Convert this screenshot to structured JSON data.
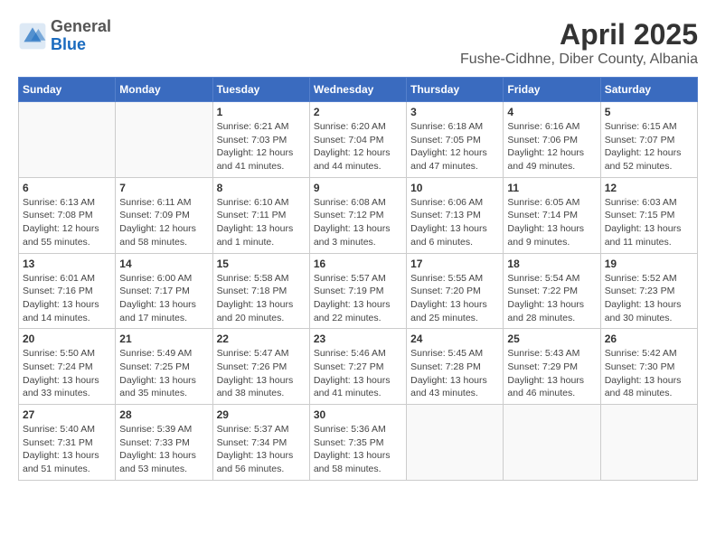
{
  "header": {
    "logo": {
      "general": "General",
      "blue": "Blue"
    },
    "month": "April 2025",
    "location": "Fushe-Cidhne, Diber County, Albania"
  },
  "weekdays": [
    "Sunday",
    "Monday",
    "Tuesday",
    "Wednesday",
    "Thursday",
    "Friday",
    "Saturday"
  ],
  "weeks": [
    [
      {
        "day": null,
        "info": null
      },
      {
        "day": null,
        "info": null
      },
      {
        "day": "1",
        "info": "Sunrise: 6:21 AM\nSunset: 7:03 PM\nDaylight: 12 hours and 41 minutes."
      },
      {
        "day": "2",
        "info": "Sunrise: 6:20 AM\nSunset: 7:04 PM\nDaylight: 12 hours and 44 minutes."
      },
      {
        "day": "3",
        "info": "Sunrise: 6:18 AM\nSunset: 7:05 PM\nDaylight: 12 hours and 47 minutes."
      },
      {
        "day": "4",
        "info": "Sunrise: 6:16 AM\nSunset: 7:06 PM\nDaylight: 12 hours and 49 minutes."
      },
      {
        "day": "5",
        "info": "Sunrise: 6:15 AM\nSunset: 7:07 PM\nDaylight: 12 hours and 52 minutes."
      }
    ],
    [
      {
        "day": "6",
        "info": "Sunrise: 6:13 AM\nSunset: 7:08 PM\nDaylight: 12 hours and 55 minutes."
      },
      {
        "day": "7",
        "info": "Sunrise: 6:11 AM\nSunset: 7:09 PM\nDaylight: 12 hours and 58 minutes."
      },
      {
        "day": "8",
        "info": "Sunrise: 6:10 AM\nSunset: 7:11 PM\nDaylight: 13 hours and 1 minute."
      },
      {
        "day": "9",
        "info": "Sunrise: 6:08 AM\nSunset: 7:12 PM\nDaylight: 13 hours and 3 minutes."
      },
      {
        "day": "10",
        "info": "Sunrise: 6:06 AM\nSunset: 7:13 PM\nDaylight: 13 hours and 6 minutes."
      },
      {
        "day": "11",
        "info": "Sunrise: 6:05 AM\nSunset: 7:14 PM\nDaylight: 13 hours and 9 minutes."
      },
      {
        "day": "12",
        "info": "Sunrise: 6:03 AM\nSunset: 7:15 PM\nDaylight: 13 hours and 11 minutes."
      }
    ],
    [
      {
        "day": "13",
        "info": "Sunrise: 6:01 AM\nSunset: 7:16 PM\nDaylight: 13 hours and 14 minutes."
      },
      {
        "day": "14",
        "info": "Sunrise: 6:00 AM\nSunset: 7:17 PM\nDaylight: 13 hours and 17 minutes."
      },
      {
        "day": "15",
        "info": "Sunrise: 5:58 AM\nSunset: 7:18 PM\nDaylight: 13 hours and 20 minutes."
      },
      {
        "day": "16",
        "info": "Sunrise: 5:57 AM\nSunset: 7:19 PM\nDaylight: 13 hours and 22 minutes."
      },
      {
        "day": "17",
        "info": "Sunrise: 5:55 AM\nSunset: 7:20 PM\nDaylight: 13 hours and 25 minutes."
      },
      {
        "day": "18",
        "info": "Sunrise: 5:54 AM\nSunset: 7:22 PM\nDaylight: 13 hours and 28 minutes."
      },
      {
        "day": "19",
        "info": "Sunrise: 5:52 AM\nSunset: 7:23 PM\nDaylight: 13 hours and 30 minutes."
      }
    ],
    [
      {
        "day": "20",
        "info": "Sunrise: 5:50 AM\nSunset: 7:24 PM\nDaylight: 13 hours and 33 minutes."
      },
      {
        "day": "21",
        "info": "Sunrise: 5:49 AM\nSunset: 7:25 PM\nDaylight: 13 hours and 35 minutes."
      },
      {
        "day": "22",
        "info": "Sunrise: 5:47 AM\nSunset: 7:26 PM\nDaylight: 13 hours and 38 minutes."
      },
      {
        "day": "23",
        "info": "Sunrise: 5:46 AM\nSunset: 7:27 PM\nDaylight: 13 hours and 41 minutes."
      },
      {
        "day": "24",
        "info": "Sunrise: 5:45 AM\nSunset: 7:28 PM\nDaylight: 13 hours and 43 minutes."
      },
      {
        "day": "25",
        "info": "Sunrise: 5:43 AM\nSunset: 7:29 PM\nDaylight: 13 hours and 46 minutes."
      },
      {
        "day": "26",
        "info": "Sunrise: 5:42 AM\nSunset: 7:30 PM\nDaylight: 13 hours and 48 minutes."
      }
    ],
    [
      {
        "day": "27",
        "info": "Sunrise: 5:40 AM\nSunset: 7:31 PM\nDaylight: 13 hours and 51 minutes."
      },
      {
        "day": "28",
        "info": "Sunrise: 5:39 AM\nSunset: 7:33 PM\nDaylight: 13 hours and 53 minutes."
      },
      {
        "day": "29",
        "info": "Sunrise: 5:37 AM\nSunset: 7:34 PM\nDaylight: 13 hours and 56 minutes."
      },
      {
        "day": "30",
        "info": "Sunrise: 5:36 AM\nSunset: 7:35 PM\nDaylight: 13 hours and 58 minutes."
      },
      {
        "day": null,
        "info": null
      },
      {
        "day": null,
        "info": null
      },
      {
        "day": null,
        "info": null
      }
    ]
  ]
}
